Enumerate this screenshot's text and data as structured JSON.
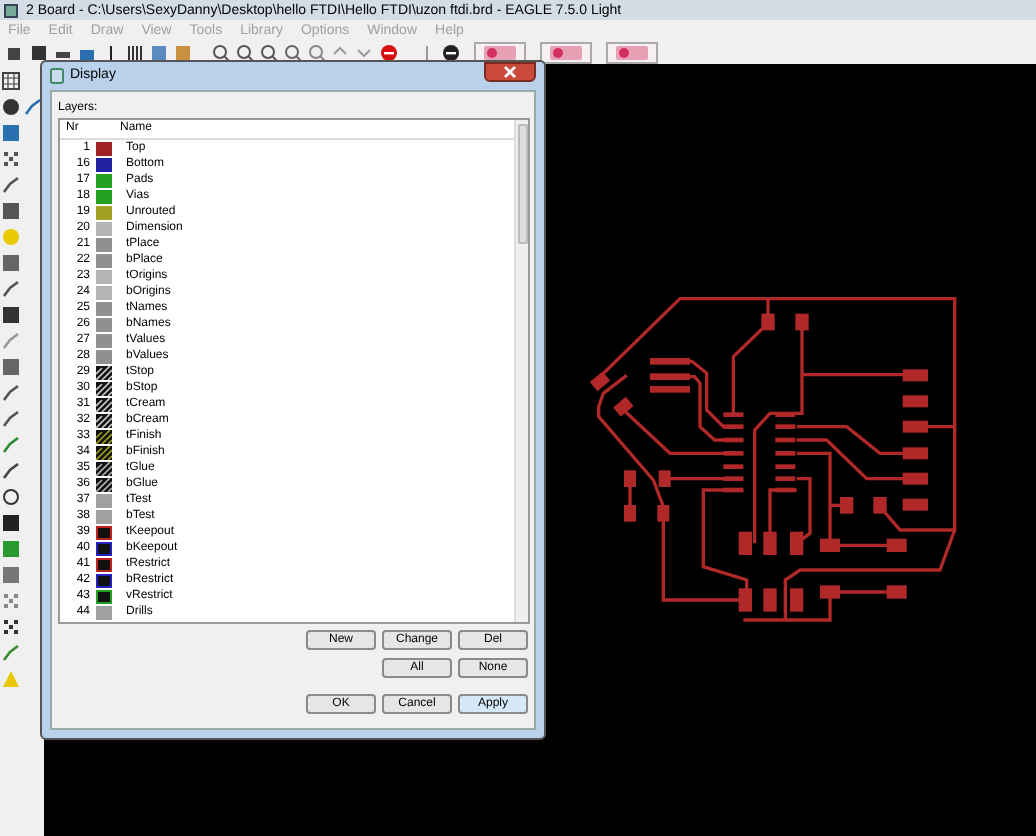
{
  "window": {
    "title": "2 Board - C:\\Users\\SexyDanny\\Desktop\\hello FTDI\\Hello FTDI\\uzon ftdi.brd - EAGLE 7.5.0 Light"
  },
  "menu": [
    "File",
    "Edit",
    "Draw",
    "View",
    "Tools",
    "Library",
    "Options",
    "Window",
    "Help"
  ],
  "dialog": {
    "title": "Display",
    "layers_label": "Layers:",
    "columns": [
      "Nr",
      "Name"
    ],
    "layers": [
      {
        "number": "1",
        "name": "Top",
        "kind": "solid",
        "color": "#a02222"
      },
      {
        "number": "16",
        "name": "Bottom",
        "kind": "solid",
        "color": "#2222a0"
      },
      {
        "number": "17",
        "name": "Pads",
        "kind": "solid",
        "color": "#22a022"
      },
      {
        "number": "18",
        "name": "Vias",
        "kind": "solid",
        "color": "#22a022"
      },
      {
        "number": "19",
        "name": "Unrouted",
        "kind": "solid",
        "color": "#a0a022"
      },
      {
        "number": "20",
        "name": "Dimension",
        "kind": "solid",
        "color": "#b4b4b4"
      },
      {
        "number": "21",
        "name": "tPlace",
        "kind": "solid",
        "color": "#909090"
      },
      {
        "number": "22",
        "name": "bPlace",
        "kind": "solid",
        "color": "#909090"
      },
      {
        "number": "23",
        "name": "tOrigins",
        "kind": "solid",
        "color": "#b4b4b4"
      },
      {
        "number": "24",
        "name": "bOrigins",
        "kind": "solid",
        "color": "#b4b4b4"
      },
      {
        "number": "25",
        "name": "tNames",
        "kind": "solid",
        "color": "#909090"
      },
      {
        "number": "26",
        "name": "bNames",
        "kind": "solid",
        "color": "#909090"
      },
      {
        "number": "27",
        "name": "tValues",
        "kind": "solid",
        "color": "#909090"
      },
      {
        "number": "28",
        "name": "bValues",
        "kind": "solid",
        "color": "#909090"
      },
      {
        "number": "29",
        "name": "tStop",
        "kind": "hatched",
        "color": "#d0d0d0"
      },
      {
        "number": "30",
        "name": "bStop",
        "kind": "hatched",
        "color": "#d0d0d0"
      },
      {
        "number": "31",
        "name": "tCream",
        "kind": "hatched",
        "color": "#d0d0d0"
      },
      {
        "number": "32",
        "name": "bCream",
        "kind": "hatched",
        "color": "#d0d0d0"
      },
      {
        "number": "33",
        "name": "tFinish",
        "kind": "hatched",
        "color": "#a0a022"
      },
      {
        "number": "34",
        "name": "bFinish",
        "kind": "hatched",
        "color": "#a0a022"
      },
      {
        "number": "35",
        "name": "tGlue",
        "kind": "hatched",
        "color": "#b4b4b4"
      },
      {
        "number": "36",
        "name": "bGlue",
        "kind": "hatched",
        "color": "#b4b4b4"
      },
      {
        "number": "37",
        "name": "tTest",
        "kind": "solid",
        "color": "#a0a0a0"
      },
      {
        "number": "38",
        "name": "bTest",
        "kind": "solid",
        "color": "#a0a0a0"
      },
      {
        "number": "39",
        "name": "tKeepout",
        "kind": "outlined",
        "color": "#c02222"
      },
      {
        "number": "40",
        "name": "bKeepout",
        "kind": "outlined",
        "color": "#2222c0"
      },
      {
        "number": "41",
        "name": "tRestrict",
        "kind": "outlined",
        "color": "#c02222"
      },
      {
        "number": "42",
        "name": "bRestrict",
        "kind": "outlined",
        "color": "#2222c0"
      },
      {
        "number": "43",
        "name": "vRestrict",
        "kind": "outlined",
        "color": "#22a022"
      },
      {
        "number": "44",
        "name": "Drills",
        "kind": "solid",
        "color": "#a0a0a0"
      }
    ],
    "edit_buttons": [
      "New",
      "Change",
      "Del"
    ],
    "select_buttons": [
      "All",
      "None"
    ],
    "dialog_buttons": [
      {
        "label": "OK",
        "default": false
      },
      {
        "label": "Cancel",
        "default": false
      },
      {
        "label": "Apply",
        "default": true
      }
    ]
  }
}
